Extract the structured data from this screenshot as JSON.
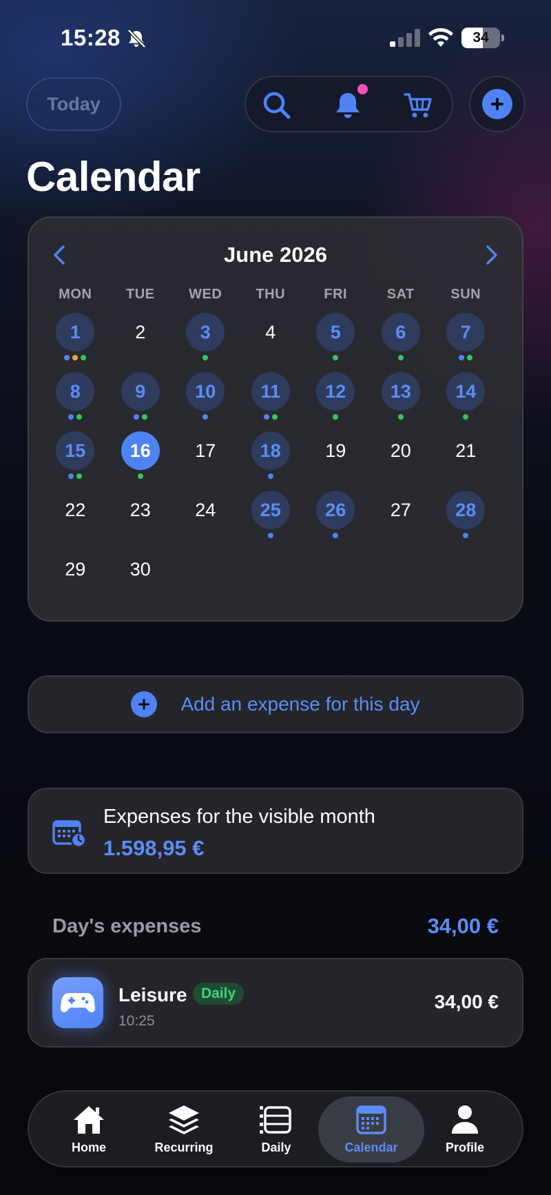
{
  "status_bar": {
    "time": "15:28",
    "battery": "34"
  },
  "header": {
    "today_label": "Today",
    "title": "Calendar"
  },
  "calendar": {
    "month_label": "June 2026",
    "weekdays": [
      "MON",
      "TUE",
      "WED",
      "THU",
      "FRI",
      "SAT",
      "SUN"
    ],
    "days": [
      {
        "num": "1",
        "has_exp": true,
        "dots": [
          "#4f82f5",
          "#f5a623",
          "#34c759"
        ]
      },
      {
        "num": "2",
        "has_exp": false,
        "dots": []
      },
      {
        "num": "3",
        "has_exp": true,
        "dots": [
          "#34c759"
        ]
      },
      {
        "num": "4",
        "has_exp": false,
        "dots": []
      },
      {
        "num": "5",
        "has_exp": true,
        "dots": [
          "#34c759"
        ]
      },
      {
        "num": "6",
        "has_exp": true,
        "dots": [
          "#34c759"
        ]
      },
      {
        "num": "7",
        "has_exp": true,
        "dots": [
          "#4f82f5",
          "#34c759"
        ]
      },
      {
        "num": "8",
        "has_exp": true,
        "dots": [
          "#4f82f5",
          "#34c759"
        ]
      },
      {
        "num": "9",
        "has_exp": true,
        "dots": [
          "#4f82f5",
          "#34c759"
        ]
      },
      {
        "num": "10",
        "has_exp": true,
        "dots": [
          "#4f82f5"
        ]
      },
      {
        "num": "11",
        "has_exp": true,
        "dots": [
          "#4f82f5",
          "#34c759"
        ]
      },
      {
        "num": "12",
        "has_exp": true,
        "dots": [
          "#34c759"
        ]
      },
      {
        "num": "13",
        "has_exp": true,
        "dots": [
          "#34c759"
        ]
      },
      {
        "num": "14",
        "has_exp": true,
        "dots": [
          "#34c759"
        ]
      },
      {
        "num": "15",
        "has_exp": true,
        "dots": [
          "#4f82f5",
          "#34c759"
        ]
      },
      {
        "num": "16",
        "has_exp": true,
        "selected": true,
        "dots": [
          "#34c759"
        ]
      },
      {
        "num": "17",
        "has_exp": false,
        "dots": []
      },
      {
        "num": "18",
        "has_exp": true,
        "dots": [
          "#4f82f5"
        ]
      },
      {
        "num": "19",
        "has_exp": false,
        "dots": []
      },
      {
        "num": "20",
        "has_exp": false,
        "dots": []
      },
      {
        "num": "21",
        "has_exp": false,
        "dots": []
      },
      {
        "num": "22",
        "has_exp": false,
        "dots": []
      },
      {
        "num": "23",
        "has_exp": false,
        "dots": []
      },
      {
        "num": "24",
        "has_exp": false,
        "dots": []
      },
      {
        "num": "25",
        "has_exp": true,
        "dots": [
          "#4f82f5"
        ]
      },
      {
        "num": "26",
        "has_exp": true,
        "dots": [
          "#4f82f5"
        ]
      },
      {
        "num": "27",
        "has_exp": false,
        "dots": []
      },
      {
        "num": "28",
        "has_exp": true,
        "dots": [
          "#4f82f5"
        ]
      },
      {
        "num": "29",
        "has_exp": false,
        "dots": []
      },
      {
        "num": "30",
        "has_exp": false,
        "dots": []
      }
    ]
  },
  "add_expense": {
    "label": "Add an expense for this day"
  },
  "month_total": {
    "label": "Expenses for the visible month",
    "value": "1.598,95 €"
  },
  "day_expenses": {
    "title": "Day's expenses",
    "total": "34,00 €",
    "items": [
      {
        "category": "Leisure",
        "badge": "Daily",
        "time": "10:25",
        "amount": "34,00 €",
        "icon": "gamepad-icon"
      }
    ]
  },
  "tabs": [
    {
      "label": "Home",
      "icon": "home-icon"
    },
    {
      "label": "Recurring",
      "icon": "layers-icon"
    },
    {
      "label": "Daily",
      "icon": "daily-list-icon"
    },
    {
      "label": "Calendar",
      "icon": "calendar-icon",
      "active": true
    },
    {
      "label": "Profile",
      "icon": "person-icon"
    }
  ],
  "colors": {
    "accent": "#4f82f5",
    "accent_text": "#5b8df6",
    "green": "#34c759",
    "orange": "#f5a623",
    "notification": "#ff4fb8"
  }
}
